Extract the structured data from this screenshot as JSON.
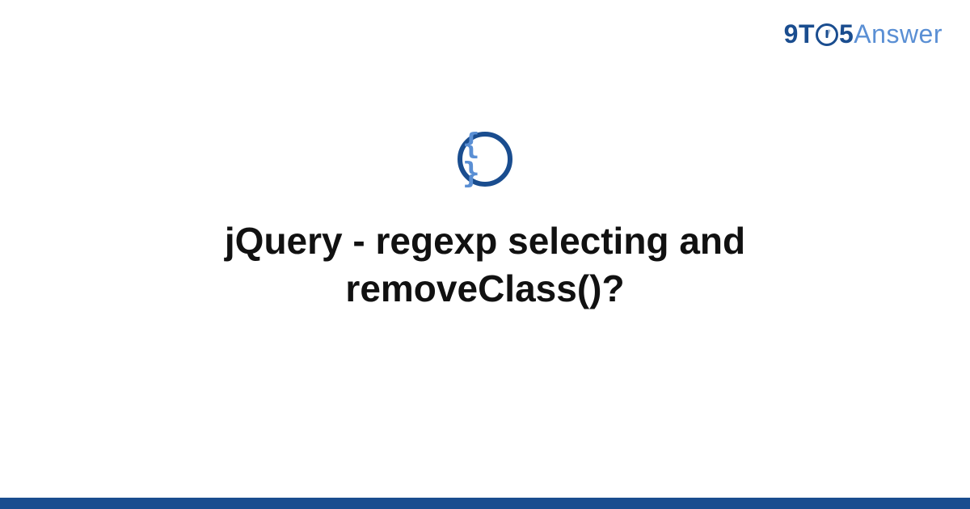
{
  "brand": {
    "part1": "9T",
    "part2": "5",
    "part3": "Answer"
  },
  "icon": {
    "symbol": "{ }",
    "name": "code-braces"
  },
  "title": "jQuery - regexp selecting and removeClass()?",
  "colors": {
    "primary": "#1a4d8f",
    "secondary": "#5a8fd4",
    "text": "#111111"
  }
}
